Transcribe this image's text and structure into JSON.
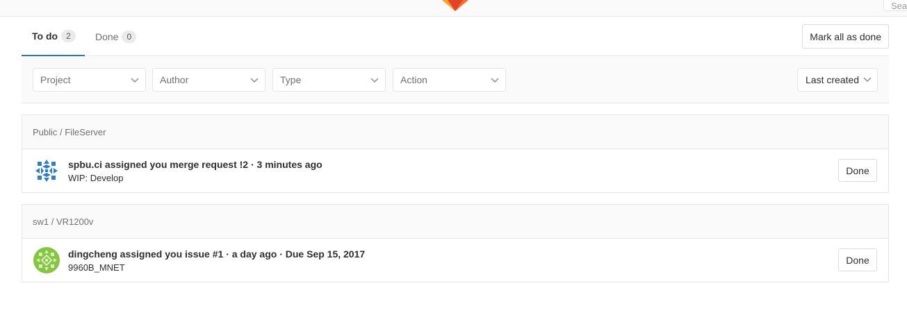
{
  "header": {
    "search_placeholder": "Search"
  },
  "tabs": [
    {
      "label": "To do",
      "count": "2"
    },
    {
      "label": "Done",
      "count": "0"
    }
  ],
  "mark_all_label": "Mark all as done",
  "filters": {
    "project": "Project",
    "author": "Author",
    "type": "Type",
    "action": "Action",
    "sort": "Last created"
  },
  "groups": [
    {
      "path": "Public / FileServer",
      "item": {
        "author": "spbu.ci",
        "action": "assigned you",
        "target": "merge request !2",
        "time": "· 3 minutes ago",
        "body": "WIP: Develop",
        "done_label": "Done"
      }
    },
    {
      "path": "sw1 / VR1200v",
      "item": {
        "author": "dingcheng",
        "action": "assigned you",
        "target": "issue #1",
        "time": "· a day ago · Due Sep 15, 2017",
        "body": "9960B_MNET",
        "done_label": "Done"
      }
    }
  ],
  "colors": {
    "accent": "#1f78d1",
    "avatar_1": "#2e7fc6",
    "avatar_2": "#86c53f"
  },
  "icons": {
    "logo": "gitlab-logo-icon",
    "dropdown": "chevron-down-icon"
  }
}
